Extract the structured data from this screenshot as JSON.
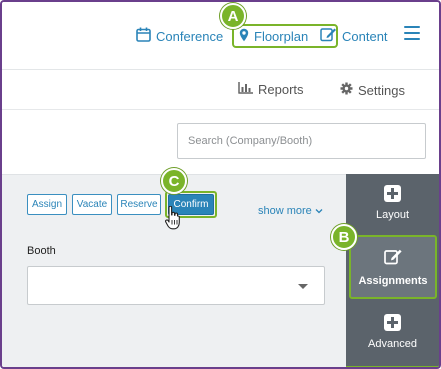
{
  "nav": {
    "conference_label": "Conference",
    "floorplan_label": "Floorplan",
    "content_label": "Content",
    "menu_icon": "hamburger-menu-icon"
  },
  "secondary_nav": {
    "reports_label": "Reports",
    "settings_label": "Settings"
  },
  "search": {
    "placeholder": "Search (Company/Booth)",
    "value": ""
  },
  "actions": {
    "assign_label": "Assign",
    "vacate_label": "Vacate",
    "reserve_label": "Reserve",
    "confirm_label": "Confirm",
    "show_more_label": "show more"
  },
  "booth": {
    "label": "Booth",
    "selected_value": ""
  },
  "sidebar": {
    "items": [
      {
        "label": "Layout",
        "icon": "plus-square-icon"
      },
      {
        "label": "Assignments",
        "icon": "edit-icon"
      },
      {
        "label": "Advanced",
        "icon": "plus-square-icon"
      }
    ]
  },
  "callouts": {
    "a": "A",
    "b": "B",
    "c": "C"
  },
  "colors": {
    "accent_blue": "#2a84b8",
    "highlight_green": "#7ab42a",
    "sidebar_gray": "#5b636b",
    "frame_purple": "#6a3f8c"
  }
}
